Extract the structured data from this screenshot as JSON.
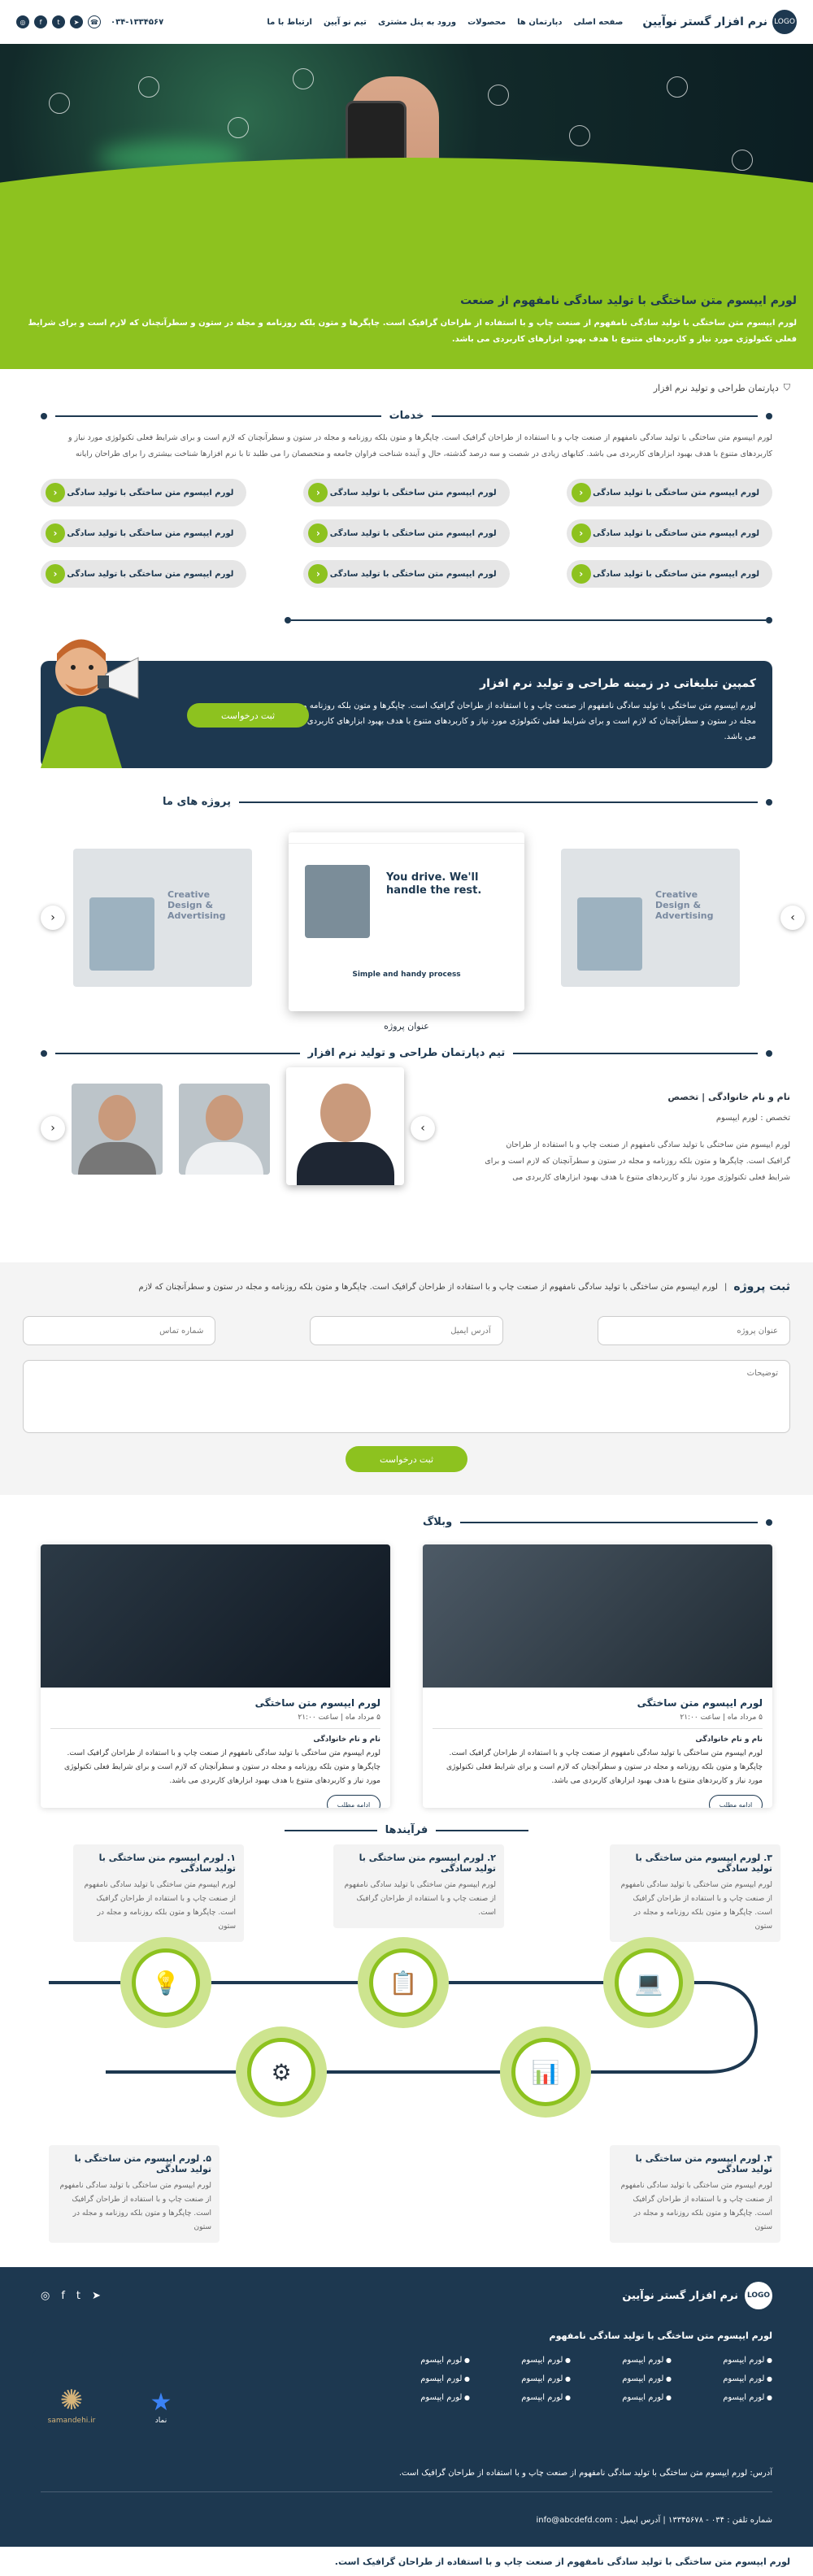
{
  "header": {
    "brand": "نرم افزار گستر نوآیین",
    "logo": "LOGO",
    "nav": [
      "صفحه اصلی",
      "دپارتمان ها",
      "محصولات",
      "ورود به پنل مشتری",
      "تیم نو آیین",
      "ارتباط با ما"
    ],
    "phone": "۰۳۴-۱۳۳۴۵۶۷"
  },
  "hero": {
    "title": "لورم ایپسوم متن ساختگی با تولید سادگی نامفهوم از صنعت",
    "text": "لورم ایپسوم متن ساختگی با تولید سادگی نامفهوم از صنعت چاپ و با استفاده از طراحان گرافیک است. چاپگرها و متون بلکه روزنامه و مجله در ستون و سطرآنچنان که لازم است و برای شرایط فعلی تکنولوژی مورد نیاز و کاربردهای متنوع با هدف بهبود ابزارهای کاربردی می باشد."
  },
  "breadcrumb": "دپارتمان طراحی و تولید نرم افزار",
  "services": {
    "title": "خدمات",
    "lead": "لورم ایپسوم متن ساختگی با تولید سادگی نامفهوم از صنعت چاپ و با استفاده از طراحان گرافیک است. چاپگرها و متون بلکه روزنامه و مجله در ستون و سطرآنچنان که لازم است و برای شرایط فعلی تکنولوژی مورد نیاز و کاربردهای متنوع با هدف بهبود ابزارهای کاربردی می باشد. کتابهای زیادی در شصت و سه درصد گذشته، حال و آینده شناخت فراوان جامعه و متخصصان را می طلبد تا با نرم افزارها شناخت بیشتری را برای طراحان رایانه",
    "items": [
      "لورم ایپسوم متن ساختگی با تولید سادگی",
      "لورم ایپسوم متن ساختگی با تولید سادگی",
      "لورم ایپسوم متن ساختگی با تولید سادگی",
      "لورم ایپسوم متن ساختگی با تولید سادگی",
      "لورم ایپسوم متن ساختگی با تولید سادگی",
      "لورم ایپسوم متن ساختگی با تولید سادگی",
      "لورم ایپسوم متن ساختگی با تولید سادگی",
      "لورم ایپسوم متن ساختگی با تولید سادگی",
      "لورم ایپسوم متن ساختگی با تولید سادگی"
    ]
  },
  "campaign": {
    "title": "کمپین تبلیغاتی در زمینه طراحی و تولید نرم افزار",
    "text": "لورم ایپسوم متن ساختگی با تولید سادگی نامفهوم از صنعت چاپ و با استفاده از طراحان گرافیک است. چاپگرها و متون بلکه روزنامه و مجله در ستون و سطرآنچنان که لازم است و برای شرایط فعلی تکنولوژی مورد نیاز و کاربردهای متنوع با هدف بهبود ابزارهای کاربردی می باشد.",
    "button": "ثبت درخواست"
  },
  "projects": {
    "title": "پروژه های ما",
    "name": "عنوان پروژه",
    "side_text": "Creative Design & Advertising",
    "mid_heading": "You drive. We'll handle the rest.",
    "mid_sub": "Simple and handy process"
  },
  "team": {
    "title": "تیم دپارتمان طراحی و تولید نرم افزار",
    "name": "نام و نام خانوادگی | تخصص",
    "role": "تخصص : لورم ایپسوم",
    "text": "لورم ایپسوم متن ساختگی با تولید سادگی نامفهوم از صنعت چاپ و با استفاده از طراحان گرافیک است. چاپگرها و متون بلکه روزنامه و مجله در ستون و سطرآنچنان که لازم است و برای شرایط فعلی تکنولوژی مورد نیاز و کاربردهای متنوع با هدف بهبود ابزارهای کاربردی می"
  },
  "form": {
    "title": "ثبت پروژه",
    "desc": "لورم ایپسوم متن ساختگی با تولید سادگی نامفهوم از صنعت چاپ و با استفاده از طراحان گرافیک است. چاپگرها و متون بلکه روزنامه و مجله در ستون و سطرآنچنان که لازم",
    "ph_title": "عنوان پروژه",
    "ph_email": "آدرس ایمیل",
    "ph_phone": "شماره تماس",
    "ph_desc": "توضیحات",
    "button": "ثبت درخواست"
  },
  "blog": {
    "title": "وبلاگ",
    "posts": [
      {
        "title": "لورم ایپسوم متن ساختگی",
        "date": "۵ مرداد ماه | ساعت ۲۱:۰۰",
        "author": "نام و نام خانوادگی",
        "text": "لورم ایپسوم متن ساختگی با تولید سادگی نامفهوم از صنعت چاپ و با استفاده از طراحان گرافیک است. چاپگرها و متون بلکه روزنامه و مجله در ستون و سطرآنچنان که لازم است و برای شرایط فعلی تکنولوژی مورد نیاز و کاربردهای متنوع با هدف بهبود ابزارهای کاربردی می باشد.",
        "more": "ادامه مطلب"
      },
      {
        "title": "لورم ایپسوم متن ساختگی",
        "date": "۵ مرداد ماه | ساعت ۲۱:۰۰",
        "author": "نام و نام خانوادگی",
        "text": "لورم ایپسوم متن ساختگی با تولید سادگی نامفهوم از صنعت چاپ و با استفاده از طراحان گرافیک است. چاپگرها و متون بلکه روزنامه و مجله در ستون و سطرآنچنان که لازم است و برای شرایط فعلی تکنولوژی مورد نیاز و کاربردهای متنوع با هدف بهبود ابزارهای کاربردی می باشد.",
        "more": "ادامه مطلب"
      }
    ]
  },
  "process": {
    "title": "فرآیندها",
    "steps": [
      {
        "title": "۱. لورم ایپسوم متن ساختگی با تولید سادگی",
        "text": "لورم ایپسوم متن ساختگی با تولید سادگی نامفهوم از صنعت چاپ و با استفاده از طراحان گرافیک است. چاپگرها و متون بلکه روزنامه و مجله در ستون"
      },
      {
        "title": "۲. لورم ایپسوم متن ساختگی با تولید سادگی",
        "text": "لورم ایپسوم متن ساختگی با تولید سادگی نامفهوم از صنعت چاپ و با استفاده از طراحان گرافیک است."
      },
      {
        "title": "۳. لورم ایپسوم متن ساختگی با تولید سادگی",
        "text": "لورم ایپسوم متن ساختگی با تولید سادگی نامفهوم از صنعت چاپ و با استفاده از طراحان گرافیک است. چاپگرها و متون بلکه روزنامه و مجله در ستون"
      },
      {
        "title": "۴. لورم ایپسوم متن ساختگی با تولید سادگی",
        "text": "لورم ایپسوم متن ساختگی با تولید سادگی نامفهوم از صنعت چاپ و با استفاده از طراحان گرافیک است. چاپگرها و متون بلکه روزنامه و مجله در ستون"
      },
      {
        "title": "۵. لورم ایپسوم متن ساختگی با تولید سادگی",
        "text": "لورم ایپسوم متن ساختگی با تولید سادگی نامفهوم از صنعت چاپ و با استفاده از طراحان گرافیک است. چاپگرها و متون بلکه روزنامه و مجله در ستون"
      }
    ]
  },
  "footer": {
    "brand": "نرم افزار گستر نوآیین",
    "logo": "LOGO",
    "heading": "لورم ایپسوم متن ساختگی با تولید سادگی نامفهوم",
    "link": "لورم ایپسوم",
    "badge1": "samandehi.ir",
    "badge2": "نماد",
    "address": "آدرس: لورم ایپسوم متن ساختگی با تولید سادگی نامفهوم از صنعت چاپ و با استفاده از طراحان گرافیک است.",
    "contact": "شماره تلفن : ۰۳۴ - ۱۳۳۴۵۶۷۸    |    آدرس ایمیل : info@abcdefd.com",
    "copyright": "لورم ایپسوم متن ساختگی با تولید سادگی نامفهوم از صنعت چاپ و با استفاده از طراحان گرافیک است."
  },
  "colors": {
    "navy": "#1d3850",
    "green": "#8dc21f"
  },
  "icons": [
    "instagram-icon",
    "facebook-icon",
    "twitter-icon",
    "telegram-icon",
    "phone-icon",
    "arrow-left-icon",
    "arrow-right-icon",
    "shield-icon"
  ]
}
